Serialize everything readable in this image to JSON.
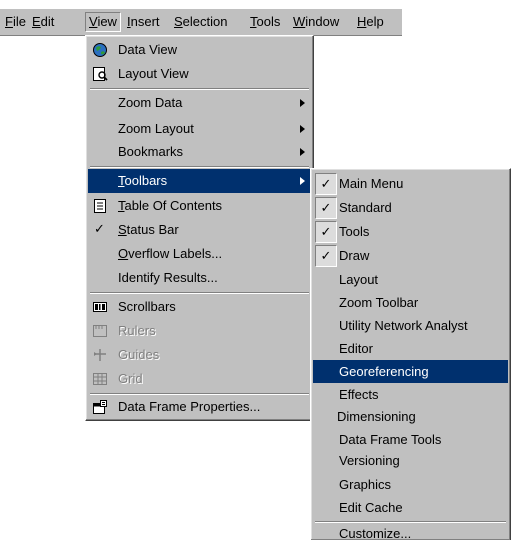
{
  "menubar": {
    "items": [
      {
        "id": "file",
        "pre": "",
        "u": "F",
        "post": "ile"
      },
      {
        "id": "edit",
        "pre": "",
        "u": "E",
        "post": "dit"
      },
      {
        "id": "view",
        "pre": "",
        "u": "V",
        "post": "iew"
      },
      {
        "id": "insert",
        "pre": "",
        "u": "I",
        "post": "nsert"
      },
      {
        "id": "selection",
        "pre": "",
        "u": "S",
        "post": "election"
      },
      {
        "id": "tools",
        "pre": "",
        "u": "T",
        "post": "ools"
      },
      {
        "id": "window",
        "pre": "",
        "u": "W",
        "post": "indow"
      },
      {
        "id": "help",
        "pre": "",
        "u": "H",
        "post": "elp"
      }
    ]
  },
  "view_menu": {
    "items": [
      {
        "pre": "",
        "u": "",
        "post": "Data View",
        "icon": "data-view-icon"
      },
      {
        "pre": "",
        "u": "",
        "post": "Layout View",
        "icon": "layout-view-icon"
      },
      {
        "pre": "",
        "u": "",
        "post": "Zoom Data",
        "submenu": true
      },
      {
        "pre": "",
        "u": "",
        "post": "Zoom Layout",
        "submenu": true
      },
      {
        "pre": "",
        "u": "",
        "post": "Bookmarks",
        "submenu": true
      },
      {
        "pre": "",
        "u": "T",
        "post": "oolbars",
        "submenu": true,
        "selected": true
      },
      {
        "pre": "",
        "u": "T",
        "post": "able Of Contents",
        "icon": "table-of-contents-icon"
      },
      {
        "pre": "",
        "u": "S",
        "post": "tatus Bar",
        "checked": true
      },
      {
        "pre": "",
        "u": "O",
        "post": "verflow Labels..."
      },
      {
        "pre": "",
        "u": "",
        "post": "Identify Results..."
      },
      {
        "pre": "",
        "u": "",
        "post": "Scrollbars",
        "icon": "scrollbars-icon"
      },
      {
        "pre": "",
        "u": "",
        "post": "Rulers",
        "icon": "rulers-icon",
        "disabled": true
      },
      {
        "pre": "",
        "u": "",
        "post": "Guides",
        "icon": "guides-icon",
        "disabled": true
      },
      {
        "pre": "",
        "u": "",
        "post": "Grid",
        "icon": "grid-icon",
        "disabled": true
      },
      {
        "pre": "",
        "u": "",
        "post": "Data Frame Properties...",
        "icon": "data-frame-properties-icon"
      }
    ]
  },
  "toolbars_menu": {
    "items": [
      {
        "label": "Main Menu",
        "checked": true
      },
      {
        "label": "Standard",
        "checked": true
      },
      {
        "label": "Tools",
        "checked": true
      },
      {
        "label": "Draw",
        "checked": true
      },
      {
        "label": "Layout"
      },
      {
        "label": "Zoom Toolbar"
      },
      {
        "label": "Utility Network Analyst"
      },
      {
        "label": "Editor"
      },
      {
        "label": "Georeferencing",
        "selected": true
      },
      {
        "label": "Effects"
      },
      {
        "label": "Dimensioning"
      },
      {
        "label": "Data Frame Tools"
      },
      {
        "label": "Versioning"
      },
      {
        "label": "Graphics"
      },
      {
        "label": "Edit Cache"
      },
      {
        "label": "Customize..."
      }
    ]
  },
  "glyphs": {
    "check": "✓"
  }
}
